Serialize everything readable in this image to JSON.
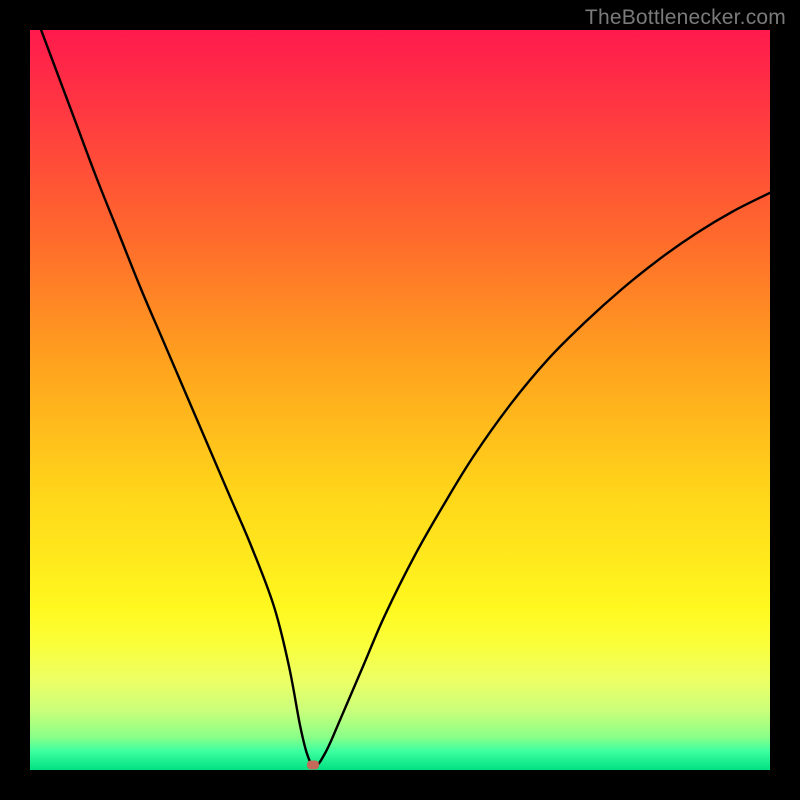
{
  "watermark": {
    "text": "TheBottlenecker.com"
  },
  "chart_data": {
    "type": "line",
    "title": "",
    "xlabel": "",
    "ylabel": "",
    "xlim": [
      0,
      100
    ],
    "ylim": [
      0,
      100
    ],
    "gradient_stops": [
      {
        "offset": 0.0,
        "color": "#ff1a4d"
      },
      {
        "offset": 0.12,
        "color": "#ff3b40"
      },
      {
        "offset": 0.28,
        "color": "#ff6a2c"
      },
      {
        "offset": 0.45,
        "color": "#ffa21e"
      },
      {
        "offset": 0.62,
        "color": "#ffd41a"
      },
      {
        "offset": 0.78,
        "color": "#fff81f"
      },
      {
        "offset": 0.83,
        "color": "#faff3a"
      },
      {
        "offset": 0.88,
        "color": "#ecff66"
      },
      {
        "offset": 0.92,
        "color": "#c9ff7a"
      },
      {
        "offset": 0.955,
        "color": "#8bff88"
      },
      {
        "offset": 0.975,
        "color": "#3cffa0"
      },
      {
        "offset": 1.0,
        "color": "#00e082"
      }
    ],
    "series": [
      {
        "name": "bottleneck-curve",
        "x": [
          0,
          3,
          6,
          9,
          12,
          15,
          18,
          21,
          24,
          27,
          30,
          33,
          35,
          36.5,
          37.5,
          38.5,
          40,
          42,
          45,
          48,
          52,
          56,
          60,
          65,
          70,
          75,
          80,
          85,
          90,
          95,
          100
        ],
        "y": [
          104,
          96,
          88,
          80,
          72.5,
          65,
          58,
          51,
          44,
          37,
          30,
          22,
          14,
          6,
          2,
          0.5,
          2.5,
          7,
          14,
          21,
          29,
          36,
          42.5,
          49.5,
          55.5,
          60.5,
          65,
          69,
          72.5,
          75.5,
          78
        ]
      }
    ],
    "marker": {
      "x": 38.2,
      "y": 0.7,
      "color": "#c46a5a"
    }
  }
}
